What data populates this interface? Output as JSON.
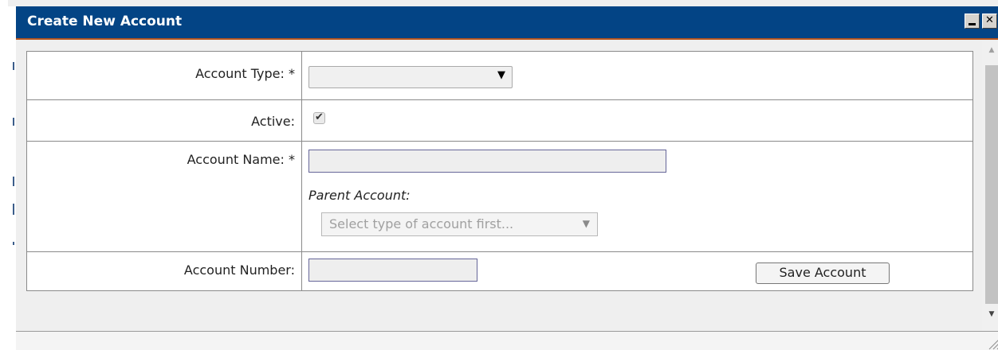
{
  "window": {
    "title": "Create New Account",
    "minimize_icon": "minimize-icon",
    "close_icon": "close-icon",
    "close_glyph": "✕",
    "accent_color": "#034485"
  },
  "form": {
    "account_type": {
      "label": "Account Type: *",
      "value": "",
      "arrow": "▼"
    },
    "active": {
      "label": "Active:",
      "checked": true,
      "check_glyph": "✔"
    },
    "account_name": {
      "label": "Account Name: *",
      "value": ""
    },
    "parent_account": {
      "label": "Parent Account:",
      "placeholder": "Select type of account first...",
      "arrow": "▼"
    },
    "account_number": {
      "label": "Account Number:",
      "value": ""
    }
  },
  "actions": {
    "save_label": "Save Account"
  },
  "scrollbar": {
    "up_glyph": "▲",
    "down_glyph": "▼"
  }
}
